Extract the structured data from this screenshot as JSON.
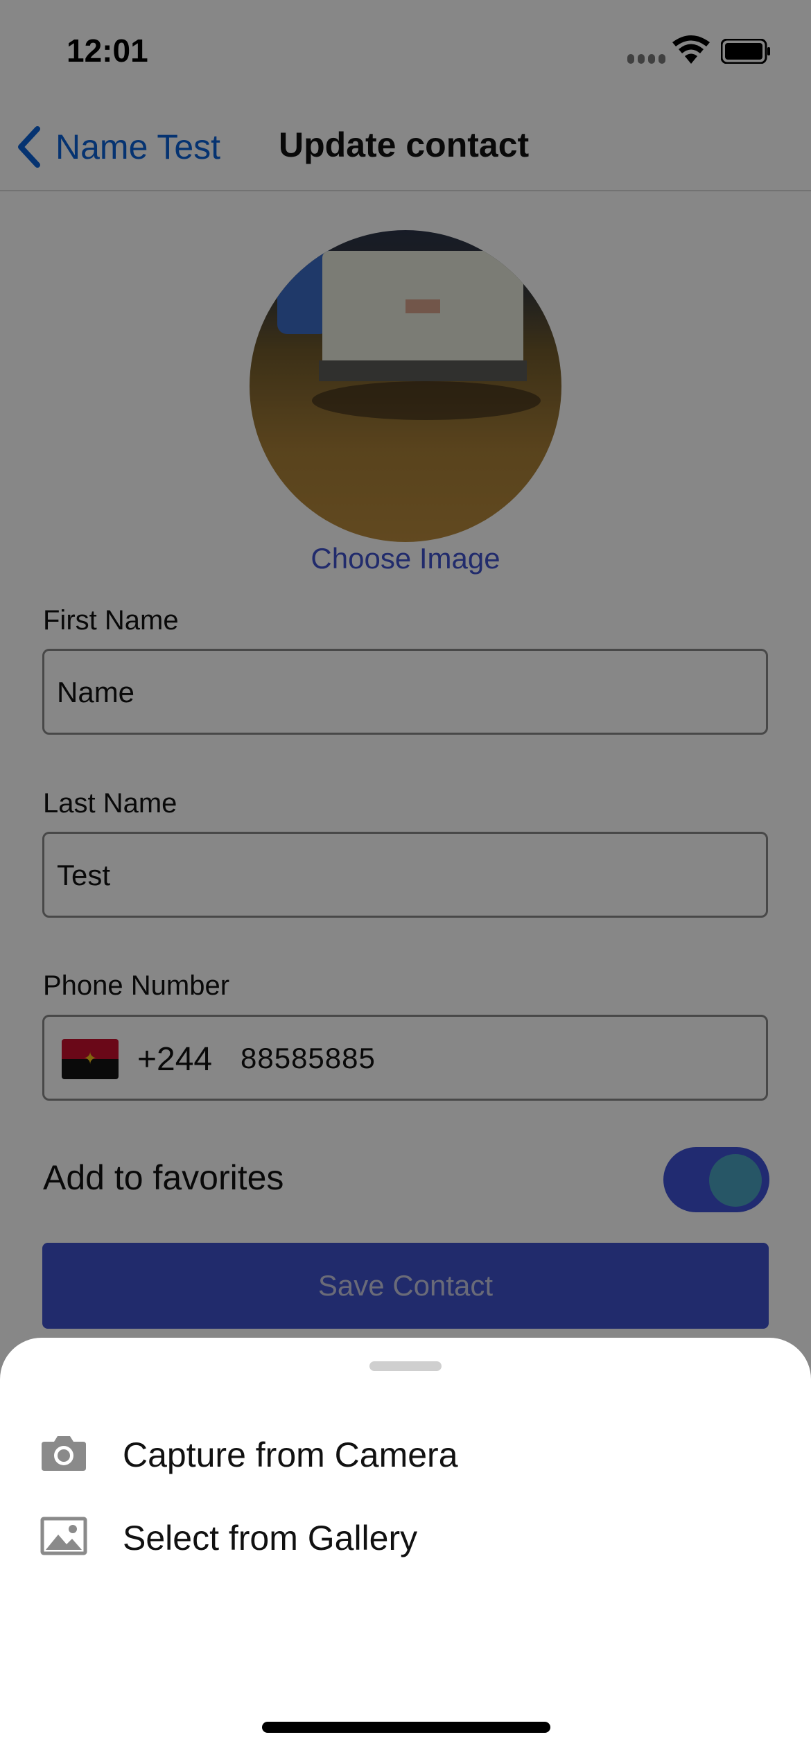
{
  "status_bar": {
    "time": "12:01"
  },
  "nav": {
    "back_label": "Name Test",
    "title": "Update contact"
  },
  "avatar": {
    "choose_label": "Choose Image"
  },
  "form": {
    "first_name": {
      "label": "First Name",
      "value": "Name"
    },
    "last_name": {
      "label": "Last Name",
      "value": "Test"
    },
    "phone": {
      "label": "Phone Number",
      "country_code": "+244",
      "value": "88585885",
      "flag": "angola-flag-icon"
    },
    "favorites": {
      "label": "Add to favorites",
      "enabled": true
    },
    "save_label": "Save Contact"
  },
  "sheet": {
    "items": [
      {
        "label": "Capture from Camera",
        "icon": "camera-icon"
      },
      {
        "label": "Select from Gallery",
        "icon": "gallery-icon"
      }
    ]
  },
  "colors": {
    "accent": "#3f51cc",
    "link": "#0a60d6",
    "toggle_knob": "#4aa3c0",
    "overlay": "rgba(0,0,0,0.47)"
  }
}
